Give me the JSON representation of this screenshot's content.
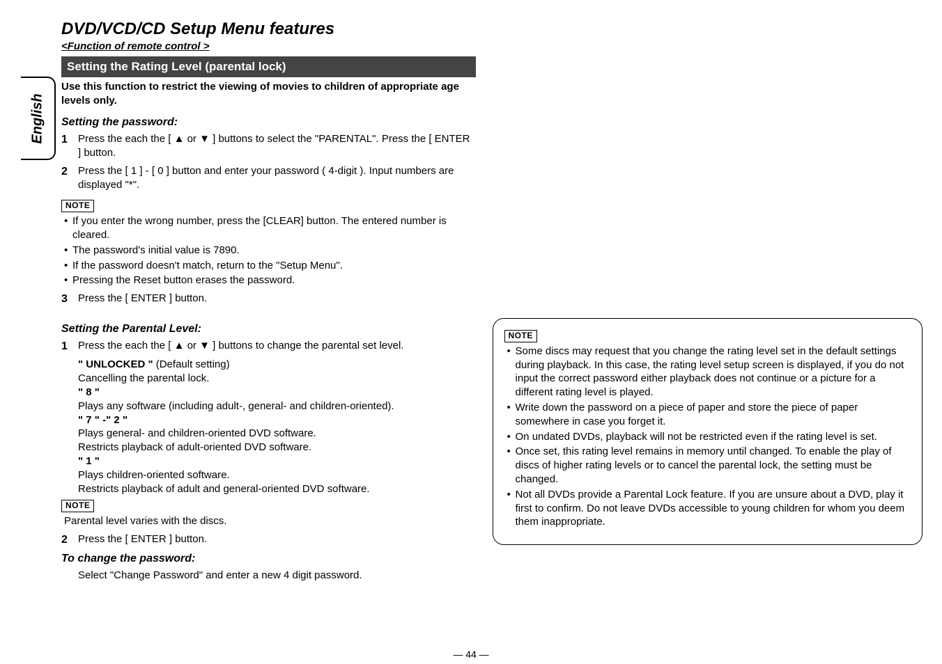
{
  "header": {
    "title": "DVD/VCD/CD Setup Menu features",
    "subtitle": "<Function of remote control >",
    "tab": "English"
  },
  "left": {
    "section_bar": "Setting the Rating Level (parental lock)",
    "intro": "Use this function to restrict the viewing of movies to children of appropriate age levels only.",
    "setting_password_heading": "Setting the password:",
    "step1_num": "1",
    "step1_body": "Press the each the [ ▲ or ▼ ] buttons to select the \"PARENTAL\". Press the [ ENTER ] button.",
    "step2_num": "2",
    "step2_body": "Press the [ 1 ] - [ 0 ] button and enter your password ( 4-digit ). Input numbers are displayed \"*\".",
    "note_label": "NOTE",
    "notes1": [
      "If you enter the wrong number, press the [CLEAR] button. The entered number is cleared.",
      "The password's initial value is 7890.",
      "If the password doesn't match, return to the \"Setup Menu\".",
      "Pressing the Reset button erases the password."
    ],
    "step3_num": "3",
    "step3_body": "Press the [ ENTER ] button.",
    "parental_heading": "Setting the Parental Level:",
    "pl_step1_num": "1",
    "pl_step1_intro": "Press the each the [ ▲ or ▼ ] buttons to change the parental set level.",
    "levels": {
      "unlocked_label": "\" UNLOCKED \" ",
      "unlocked_default": "(Default setting)",
      "unlocked_desc": "Cancelling the parental lock.",
      "l8_label": "\" 8 \"",
      "l8_desc": "Plays any software (including adult-, general- and children-oriented).",
      "l72_label": "\" 7 \" -\" 2 \"",
      "l72_desc1": "Plays general- and children-oriented DVD software.",
      "l72_desc2": "Restricts playback of adult-oriented DVD software.",
      "l1_label": "\" 1 \"",
      "l1_desc1": "Plays children-oriented software.",
      "l1_desc2": "Restricts playback of adult and general-oriented DVD software."
    },
    "notes2_text": "Parental level varies with the discs.",
    "pl_step2_num": "2",
    "pl_step2_body": "Press the [ ENTER ] button.",
    "change_pw_heading": "To change the password:",
    "change_pw_body": "Select \"Change Password\" and enter a new 4 digit password."
  },
  "right": {
    "note_label": "NOTE",
    "notes": [
      "Some discs may request that you change the rating level set in the default settings during playback. In this case, the rating level setup screen is displayed, if you do not input the correct password either playback does not continue or a picture for a different rating level is played.",
      "Write down the password on a piece of paper and store the piece of paper somewhere in case you forget it.",
      "On undated DVDs, playback will not be restricted even if the rating level is set.",
      "Once set, this rating level remains in memory until changed. To enable the play of discs of higher rating levels or to cancel the parental lock, the setting must be changed.",
      "Not all DVDs provide a Parental Lock feature. If you are unsure about a DVD, play it first to confirm. Do not leave DVDs accessible to young children for whom you deem them inappropriate."
    ]
  },
  "footer": {
    "page": "— 44 —"
  }
}
